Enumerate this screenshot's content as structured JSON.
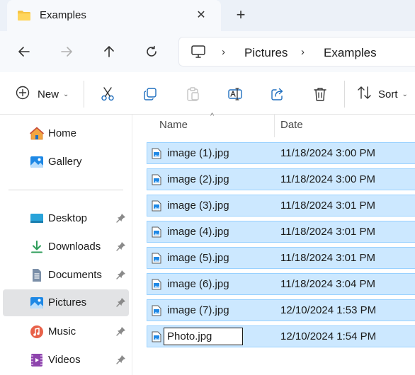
{
  "tab": {
    "title": "Examples",
    "close": "✕",
    "new_tab": "+"
  },
  "address": {
    "crumbs": [
      "Pictures",
      "Examples"
    ],
    "separator": "›"
  },
  "commands": {
    "new_label": "New",
    "sort_label": "Sort"
  },
  "sidebar": {
    "items": [
      {
        "label": "Home",
        "icon": "home-icon"
      },
      {
        "label": "Gallery",
        "icon": "gallery-icon"
      },
      {
        "label": "Desktop",
        "icon": "desktop-icon",
        "pinned": true
      },
      {
        "label": "Downloads",
        "icon": "downloads-icon",
        "pinned": true
      },
      {
        "label": "Documents",
        "icon": "documents-icon",
        "pinned": true
      },
      {
        "label": "Pictures",
        "icon": "pictures-icon",
        "pinned": true,
        "selected": true
      },
      {
        "label": "Music",
        "icon": "music-icon",
        "pinned": true
      },
      {
        "label": "Videos",
        "icon": "videos-icon",
        "pinned": true
      }
    ]
  },
  "list": {
    "columns": {
      "name": "Name",
      "date": "Date"
    },
    "files": [
      {
        "name": "image (1).jpg",
        "date": "11/18/2024 3:00 PM"
      },
      {
        "name": "image (2).jpg",
        "date": "11/18/2024 3:00 PM"
      },
      {
        "name": "image (3).jpg",
        "date": "11/18/2024 3:01 PM"
      },
      {
        "name": "image (4).jpg",
        "date": "11/18/2024 3:01 PM"
      },
      {
        "name": "image (5).jpg",
        "date": "11/18/2024 3:01 PM"
      },
      {
        "name": "image (6).jpg",
        "date": "11/18/2024 3:04 PM"
      },
      {
        "name": "image (7).jpg",
        "date": "12/10/2024 1:53 PM"
      }
    ],
    "renaming": {
      "value": "Photo.jpg",
      "date": "12/10/2024 1:54 PM"
    }
  },
  "colors": {
    "selection_fill": "#cce8ff",
    "selection_border": "#99d1ff",
    "accent": "#0067c0"
  }
}
